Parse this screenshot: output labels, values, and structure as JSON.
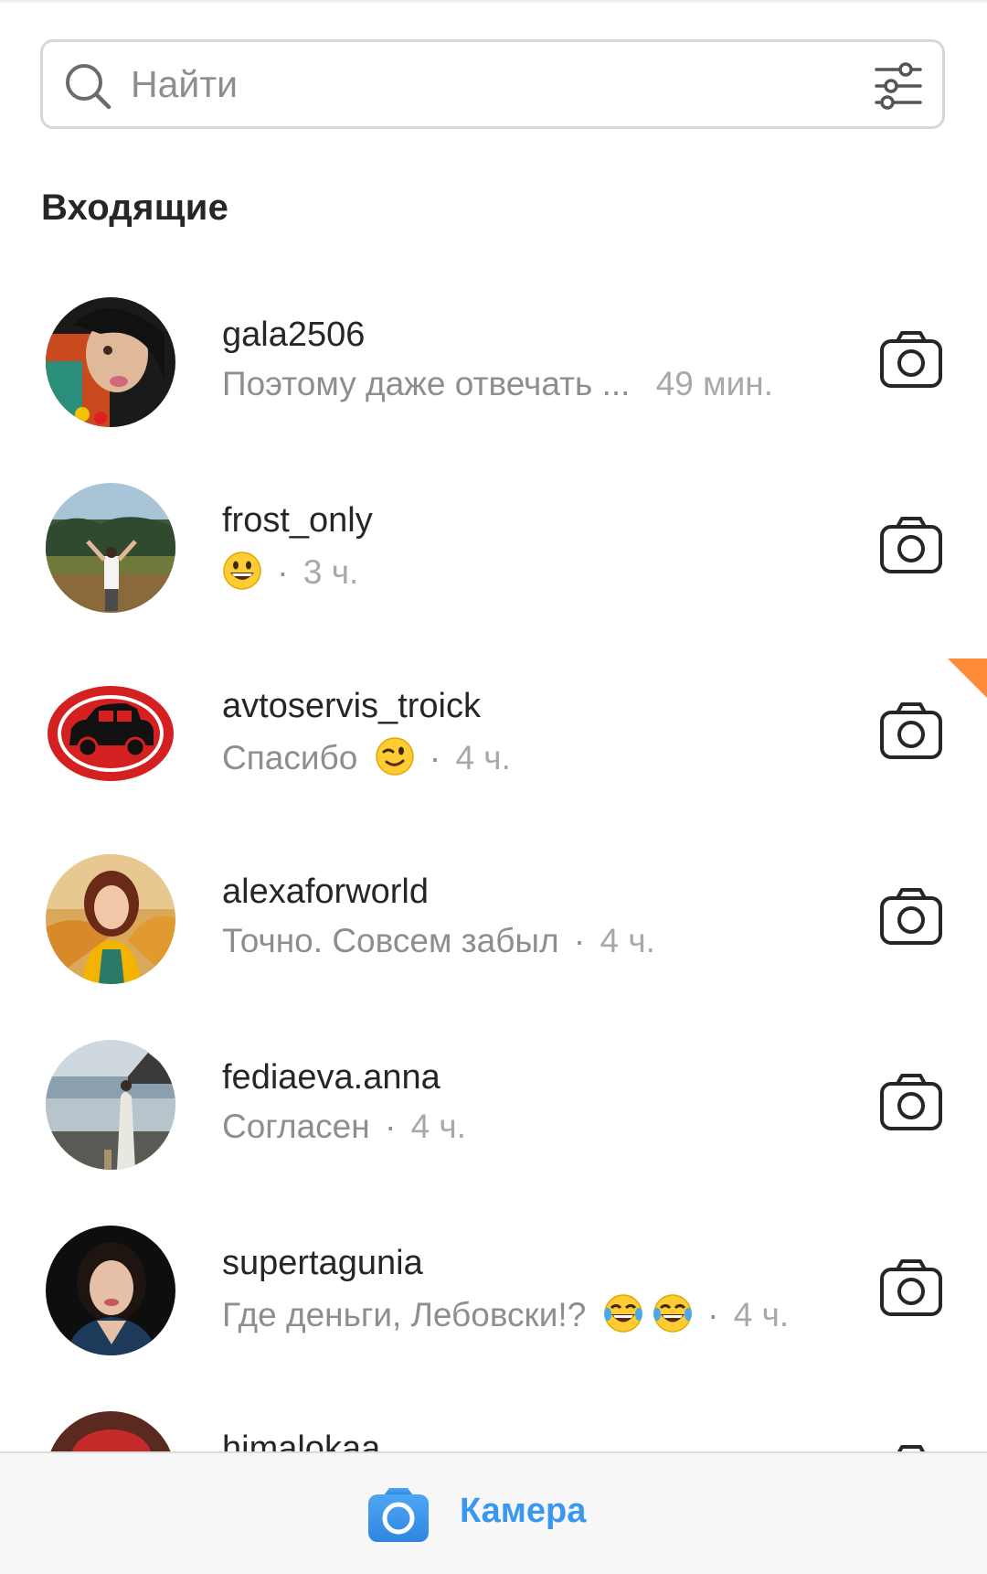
{
  "search": {
    "placeholder": "Найти",
    "icon": "search-icon",
    "filter_icon": "sliders-icon"
  },
  "section": {
    "title": "Входящие"
  },
  "threads": [
    {
      "username": "gala2506",
      "message": "Поэтому даже отвечать ...",
      "emoji": [],
      "separator": "",
      "time": "49 мин."
    },
    {
      "username": "frost_only",
      "message": "",
      "emoji": [
        "grinning-face"
      ],
      "separator": "·",
      "time": "3 ч."
    },
    {
      "username": "avtoservis_troick",
      "message": "Спасибо",
      "emoji": [
        "winking-face"
      ],
      "separator": "·",
      "time": "4 ч."
    },
    {
      "username": "alexaforworld",
      "message": "Точно. Совсем забыл",
      "emoji": [],
      "separator": "·",
      "time": "4 ч."
    },
    {
      "username": "fediaeva.anna",
      "message": "Согласен",
      "emoji": [],
      "separator": "·",
      "time": "4 ч."
    },
    {
      "username": "supertagunia",
      "message": "Где деньги, Лебовски!?",
      "emoji": [
        "tears-of-joy",
        "tears-of-joy"
      ],
      "separator": "·",
      "time": "4 ч."
    },
    {
      "username": "himalokaa",
      "message": "",
      "emoji": [],
      "separator": "",
      "time": ""
    }
  ],
  "bottom_bar": {
    "camera_label": "Камера",
    "icon": "camera-icon"
  },
  "colors": {
    "accent": "#3897f0",
    "text_primary": "#262626",
    "text_secondary": "#8e8e8e",
    "corner_badge": "#ff8a3a"
  }
}
